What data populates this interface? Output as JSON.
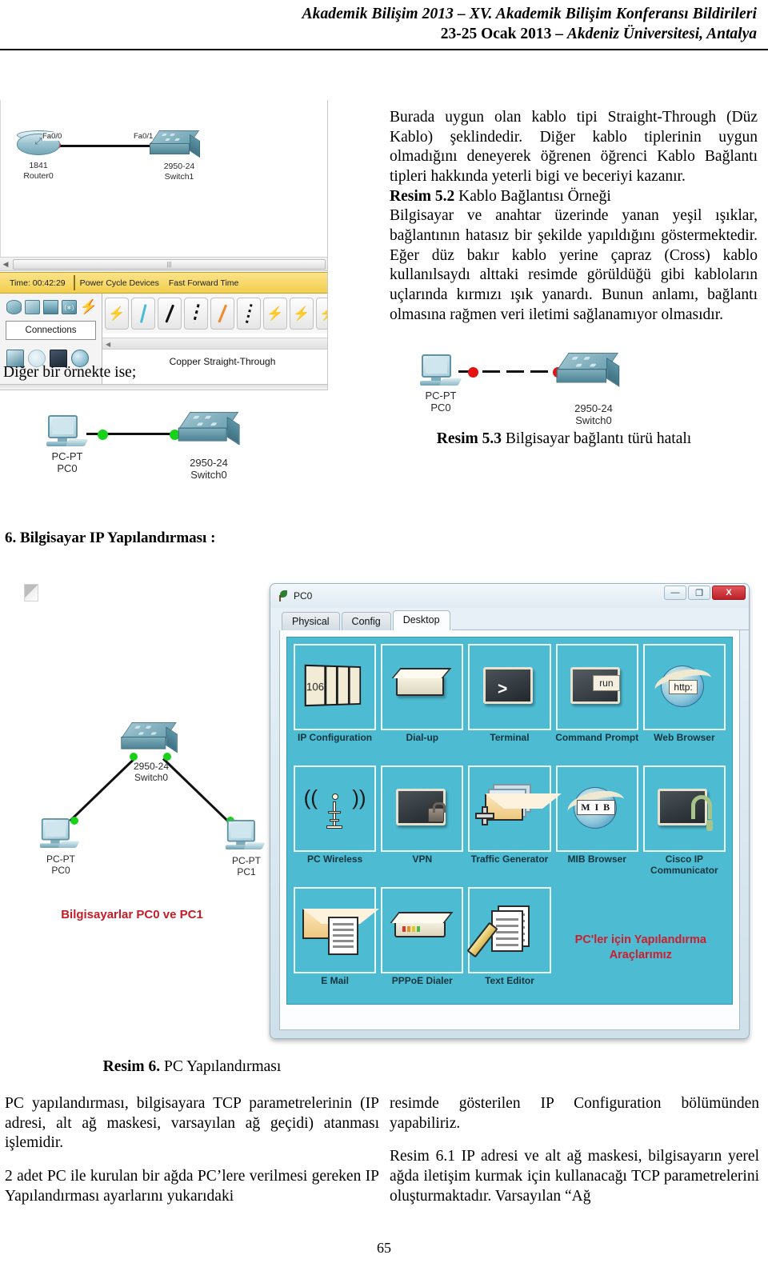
{
  "header": {
    "line1": "Akademik Bilişim 2013 – XV. Akademik Bilişim Konferansı Bildirileri",
    "line2_bold": "23-25 Ocak 2013 – ",
    "line2_italic": "Akdeniz Üniversitesi, Antalya"
  },
  "packet_tracer": {
    "topology": {
      "router": {
        "model": "1841",
        "name": "Router0",
        "port": "Fa0/0"
      },
      "switch": {
        "model": "2950-24",
        "name": "Switch1",
        "port": "Fa0/1"
      },
      "link_status": "red"
    },
    "time_bar": {
      "time_label": "Time: 00:42:29",
      "power_cycle": "Power Cycle Devices",
      "fast_forward": "Fast Forward Time"
    },
    "connections_button": "Connections",
    "selected_cable": "Copper Straight-Through",
    "scroll_grip": "|||"
  },
  "right_text": {
    "p1_part1": "Burada uygun olan kablo tipi Straight-Through (Düz Kablo) şeklindedir. Diğer kablo tiplerinin uygun olmadığını deneyerek öğrenen öğrenci Kablo Bağlantı tipleri hakkında yeterli bigi ve beceriyi kazanır.",
    "caption_52_bold": "Resim 5.2",
    "caption_52_rest": " Kablo Bağlantısı Örneği",
    "p2": "Bilgisayar ve anahtar üzerinde yanan yeşil ışıklar, bağlantının hatasız bir şekilde yapıldığını göstermektedir. Eğer düz bakır kablo yerine çapraz (Cross) kablo kullanılsaydı alttaki resimde görüldüğü gibi kabloların uçlarında kırmızı ışık yanardı. Bunun anlamı, bağlantı olmasına rağmen veri iletimi sağlanamıyor olmasıdır."
  },
  "figure_53": {
    "pc_model": "PC-PT",
    "pc_name": "PC0",
    "switch_model": "2950-24",
    "switch_name": "Switch0",
    "link_status": "red",
    "caption_bold": "Resim 5.3",
    "caption_rest": " Bilgisayar bağlantı türü hatalı"
  },
  "middle": {
    "lead_text": "Diğer bir örnekte ise;",
    "figure_green": {
      "pc_model": "PC-PT",
      "pc_name": "PC0",
      "switch_model": "2950-24",
      "switch_name": "Switch0",
      "link_status": "green"
    }
  },
  "section_heading": "6. Bilgisayar IP Yapılandırması :",
  "topology_two_pc": {
    "switch_model": "2950-24",
    "switch_name": "Switch0",
    "pc0_model": "PC-PT",
    "pc0_name": "PC0",
    "pc1_model": "PC-PT",
    "pc1_name": "PC1",
    "annotation": "Bilgisayarlar PC0 ve PC1"
  },
  "pc_window": {
    "title": "PC0",
    "tabs": [
      {
        "label": "Physical",
        "active": false
      },
      {
        "label": "Config",
        "active": false
      },
      {
        "label": "Desktop",
        "active": true
      }
    ],
    "window_buttons": {
      "minimize": "—",
      "maximize": "❐",
      "close": "X"
    },
    "desktop_items": [
      {
        "label": "IP Configuration",
        "icon": "ip-configuration-icon",
        "badge": "106"
      },
      {
        "label": "Dial-up",
        "icon": "modem-icon"
      },
      {
        "label": "Terminal",
        "icon": "terminal-icon",
        "glyph": ">"
      },
      {
        "label": "Command Prompt",
        "icon": "command-prompt-icon",
        "badge": "run"
      },
      {
        "label": "Web Browser",
        "icon": "web-browser-icon",
        "badge": "http:"
      },
      {
        "label": "PC Wireless",
        "icon": "wireless-tower-icon"
      },
      {
        "label": "VPN",
        "icon": "vpn-lock-icon"
      },
      {
        "label": "Traffic Generator",
        "icon": "traffic-generator-icon"
      },
      {
        "label": "MIB Browser",
        "icon": "mib-browser-icon",
        "badge": "M I B"
      },
      {
        "label": "Cisco IP Communicator",
        "icon": "ip-communicator-icon"
      },
      {
        "label": "E Mail",
        "icon": "email-icon"
      },
      {
        "label": "PPPoE Dialer",
        "icon": "pppoe-dialer-icon"
      },
      {
        "label": "Text Editor",
        "icon": "text-editor-icon"
      }
    ],
    "annotation": "PC'ler için Yapılandırma Araçlarımız"
  },
  "bottom": {
    "caption6_bold": "Resim 6.",
    "caption6_rest": " PC Yapılandırması",
    "left_p1": "PC yapılandırması, bilgisayara TCP parametrelerinin (IP adresi, alt ağ maskesi, varsayılan ağ geçidi) atanması işlemidir.",
    "left_p2": "2 adet PC ile kurulan bir ağda PC’lere verilmesi gereken IP Yapılandırması ayarlarını yukarıdaki",
    "right_p1": "resimde gösterilen IP Configuration bölümünden yapabiliriz.",
    "right_p2": "Resim 6.1 IP adresi ve alt ağ maskesi, bilgisayarın yerel ağda iletişim kurmak için kullanacağı TCP parametrelerini oluşturmaktadır. Varsayılan “Ağ",
    "page_number": "65"
  }
}
